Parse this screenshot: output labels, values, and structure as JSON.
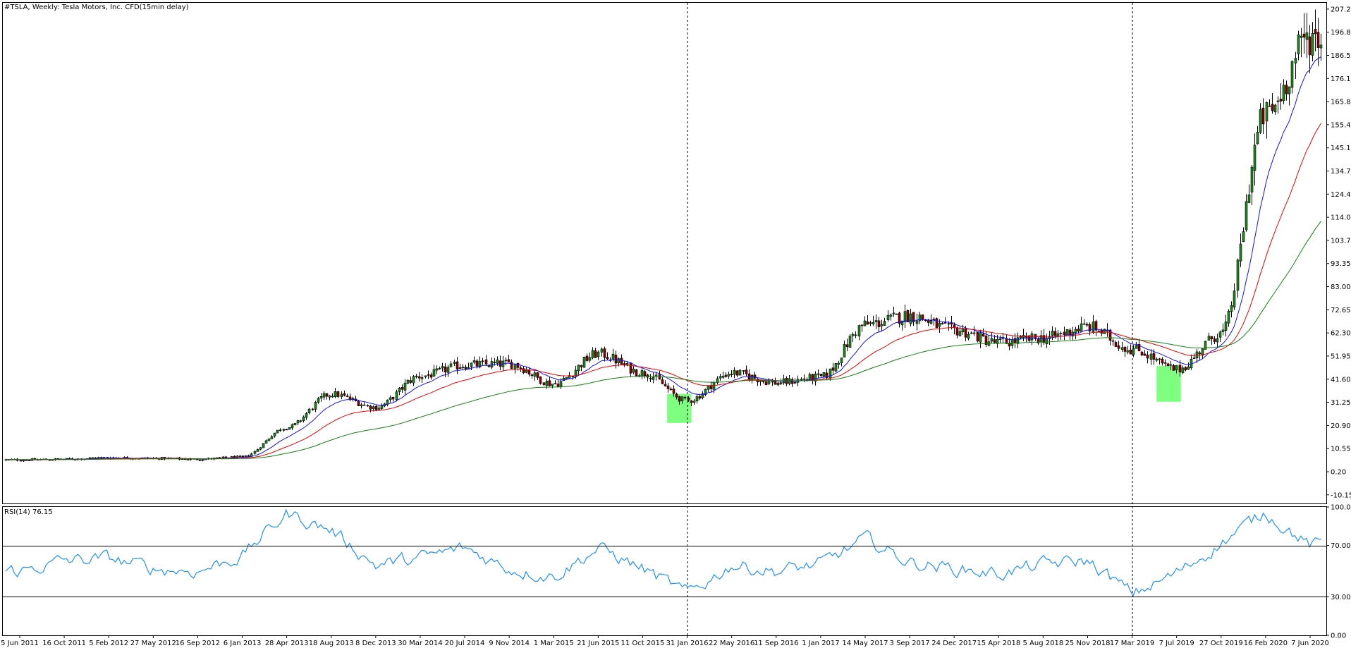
{
  "header": {
    "symbol_line": "#TSLA, Weekly:  Tesla Motors, Inc.  CFD(15min delay)"
  },
  "rsi_header": {
    "label": "RSI(14) 76.15"
  },
  "colors": {
    "background": "#ffffff",
    "candle_up": "#1a8a1a",
    "candle_down": "#8b0000",
    "ma_fast": "#1010ff",
    "ma_mid": "#ee0000",
    "ma_slow": "#138013",
    "rsi_line": "#1e90ff",
    "highlight": "#7fff7f"
  },
  "chart_data": [
    {
      "type": "candlestick",
      "title": "#TSLA, Weekly:  Tesla Motors, Inc.  CFD(15min delay)",
      "y_ticks": [
        "207.20",
        "196.85",
        "186.50",
        "176.15",
        "165.80",
        "155.45",
        "145.10",
        "134.75",
        "124.40",
        "114.05",
        "103.70",
        "93.35",
        "83.00",
        "72.65",
        "62.30",
        "51.95",
        "41.60",
        "31.25",
        "20.90",
        "10.55",
        "0.20",
        "-10.15"
      ],
      "ylim": [
        -14,
        210
      ],
      "x_tick_labels": [
        "5 Jun 2011",
        "16 Oct 2011",
        "5 Feb 2012",
        "27 May 2012",
        "16 Sep 2012",
        "6 Jan 2013",
        "28 Apr 2013",
        "18 Aug 2013",
        "8 Dec 2013",
        "30 Mar 2014",
        "20 Jul 2014",
        "9 Nov 2014",
        "1 Mar 2015",
        "21 Jun 2015",
        "11 Oct 2015",
        "31 Jan 2016",
        "22 May 2016",
        "11 Sep 2016",
        "1 Jan 2017",
        "14 May 2017",
        "3 Sep 2017",
        "24 Dec 2017",
        "15 Apr 2018",
        "5 Aug 2018",
        "25 Nov 2018",
        "17 Mar 2019",
        "7 Jul 2019",
        "27 Oct 2019",
        "16 Feb 2020",
        "7 Jun 2020"
      ],
      "price_path": [
        [
          "5 Jun 2011",
          5.5
        ],
        [
          "16 Oct 2011",
          5.8
        ],
        [
          "5 Feb 2012",
          6.5
        ],
        [
          "27 May 2012",
          6.2
        ],
        [
          "16 Sep 2012",
          5.8
        ],
        [
          "6 Jan 2013",
          6.8
        ],
        [
          "28 Apr 2013",
          20.0
        ],
        [
          "18 Aug 2013",
          35.0
        ],
        [
          "8 Dec 2013",
          29.0
        ],
        [
          "30 Mar 2014",
          43.0
        ],
        [
          "20 Jul 2014",
          48.0
        ],
        [
          "9 Nov 2014",
          48.5
        ],
        [
          "1 Mar 2015",
          39.5
        ],
        [
          "21 Jun 2015",
          53.0
        ],
        [
          "11 Oct 2015",
          44.5
        ],
        [
          "31 Jan 2016",
          32.0
        ],
        [
          "22 May 2016",
          44.5
        ],
        [
          "11 Sep 2016",
          40.0
        ],
        [
          "1 Jan 2017",
          42.5
        ],
        [
          "14 May 2017",
          66.0
        ],
        [
          "3 Sep 2017",
          70.0
        ],
        [
          "24 Dec 2017",
          63.5
        ],
        [
          "15 Apr 2018",
          58.0
        ],
        [
          "5 Aug 2018",
          60.0
        ],
        [
          "25 Nov 2018",
          65.0
        ],
        [
          "17 Mar 2019",
          55.0
        ],
        [
          "7 Jul 2019",
          46.0
        ],
        [
          "27 Oct 2019",
          62.0
        ],
        [
          "16 Feb 2020",
          160.0
        ],
        [
          "7 Jun 2020",
          195.0
        ]
      ],
      "series": [
        {
          "name": "",
          "kind": "moving-average",
          "color": "#1010ff"
        },
        {
          "name": "",
          "kind": "moving-average",
          "color": "#ee0000"
        },
        {
          "name": "",
          "kind": "moving-average",
          "color": "#138013"
        }
      ],
      "vertical_markers": [
        "31 Jan 2016",
        "17 Mar 2019"
      ],
      "highlights": [
        {
          "x_range": [
            "11 Oct 2015",
            "31 Jan 2016"
          ],
          "y_range": [
            22.0,
            35.0
          ]
        },
        {
          "x_range": [
            "17 Mar 2019",
            "7 Jul 2019"
          ],
          "y_range": [
            31.5,
            47.5
          ]
        }
      ],
      "grid": false
    },
    {
      "type": "line",
      "title": "RSI(14) 76.15",
      "series": [
        {
          "name": "RSI(14)",
          "last_value": 76.15
        }
      ],
      "y_ticks": [
        "100.00",
        "70.00",
        "30.00",
        "0.00"
      ],
      "ylim": [
        0,
        100
      ],
      "levels": [
        70,
        30
      ],
      "rsi_path": [
        [
          "5 Jun 2011",
          50
        ],
        [
          "16 Oct 2011",
          58
        ],
        [
          "5 Feb 2012",
          60
        ],
        [
          "27 May 2012",
          52
        ],
        [
          "16 Sep 2012",
          50
        ],
        [
          "6 Jan 2013",
          62
        ],
        [
          "28 Apr 2013",
          95
        ],
        [
          "18 Aug 2013",
          82
        ],
        [
          "8 Dec 2013",
          55
        ],
        [
          "30 Mar 2014",
          60
        ],
        [
          "20 Jul 2014",
          68
        ],
        [
          "9 Nov 2014",
          52
        ],
        [
          "1 Mar 2015",
          46
        ],
        [
          "21 Jun 2015",
          68
        ],
        [
          "11 Oct 2015",
          52
        ],
        [
          "31 Jan 2016",
          32
        ],
        [
          "22 May 2016",
          55
        ],
        [
          "11 Sep 2016",
          50
        ],
        [
          "1 Jan 2017",
          55
        ],
        [
          "14 May 2017",
          75
        ],
        [
          "3 Sep 2017",
          57
        ],
        [
          "24 Dec 2017",
          52
        ],
        [
          "15 Apr 2018",
          48
        ],
        [
          "5 Aug 2018",
          55
        ],
        [
          "25 Nov 2018",
          58
        ],
        [
          "17 Mar 2019",
          32
        ],
        [
          "7 Jul 2019",
          48
        ],
        [
          "27 Oct 2019",
          72
        ],
        [
          "16 Feb 2020",
          96
        ],
        [
          "7 Jun 2020",
          70
        ]
      ],
      "grid": false
    }
  ]
}
